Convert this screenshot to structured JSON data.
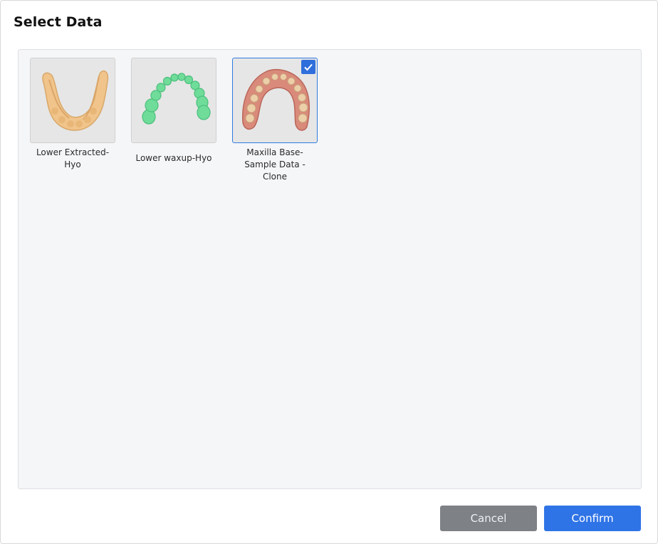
{
  "dialog": {
    "title": "Select Data"
  },
  "items": [
    {
      "label_line1": "Lower Extracted-",
      "label_line2": "Hyo",
      "selected": false,
      "thumbnail": "lower-jaw-model-tan"
    },
    {
      "label_line1": "Lower waxup-Hyo",
      "label_line2": "",
      "selected": false,
      "thumbnail": "tooth-crowns-model-green"
    },
    {
      "label_line1": "Maxilla Base-",
      "label_line2": "Sample Data - Clone",
      "selected": true,
      "thumbnail": "maxilla-scan-model"
    }
  ],
  "footer": {
    "cancel_label": "Cancel",
    "confirm_label": "Confirm"
  },
  "colors": {
    "accent": "#2f74e6",
    "cancel_bg": "#7e8186",
    "panel_bg": "#f5f6f8"
  },
  "icons": {
    "selected_check": "checkmark-icon"
  }
}
